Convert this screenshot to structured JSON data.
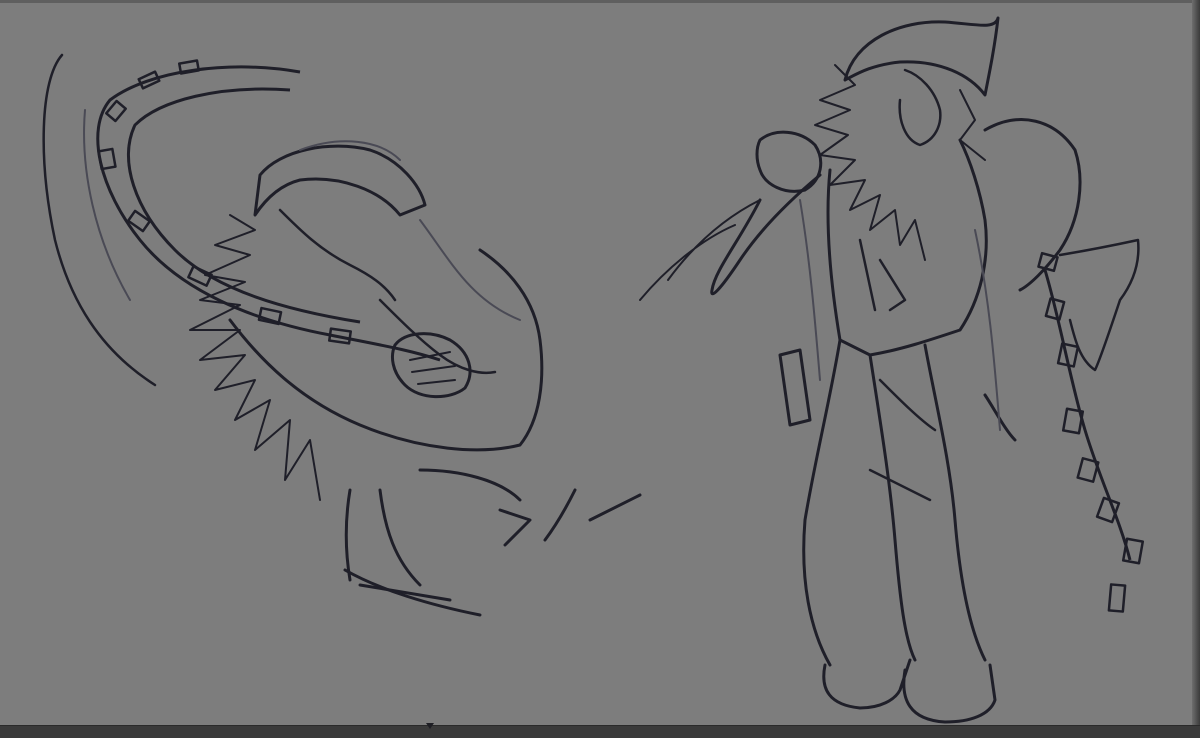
{
  "canvas": {
    "background_color": "#7d7d7d",
    "ink_color": "#1f1f29",
    "sketch_subjects": [
      "crouching-figure-with-chain",
      "standing-figure-with-chain"
    ]
  }
}
